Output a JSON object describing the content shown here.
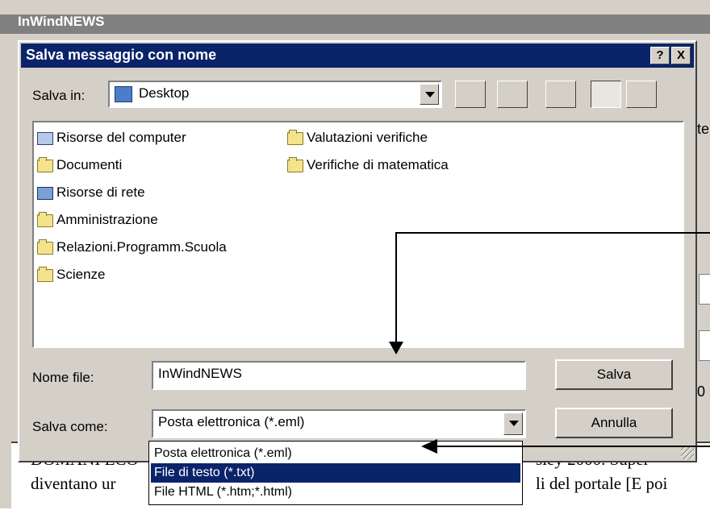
{
  "background": {
    "app_title": "InWindNEWS",
    "doc_lines": [
      "DOMANI ECO",
      "diventano ur",
      "sley 2000.   Super",
      "li del portale [E poi"
    ],
    "right_glyphs": [
      "te",
      "0"
    ]
  },
  "dialog": {
    "title": "Salva messaggio con nome",
    "help_label": "?",
    "close_label": "X",
    "save_in_label": "Salva in:",
    "save_in_value": "Desktop",
    "files_col1": [
      "Risorse del computer",
      "Documenti",
      "Risorse di rete",
      "Amministrazione",
      "Relazioni.Programm.Scuola",
      "Scienze"
    ],
    "files_col2": [
      "Valutazioni verifiche",
      "Verifiche di matematica"
    ],
    "filename_label": "Nome file:",
    "filename_value": "InWindNEWS",
    "saveas_label": "Salva come:",
    "saveas_value": "Posta elettronica (*.eml)",
    "save_button": "Salva",
    "cancel_button": "Annulla",
    "type_options": [
      "Posta elettronica (*.eml)",
      "File di testo (*.txt)",
      "File HTML (*.htm;*.html)"
    ],
    "selected_option_index": 1
  },
  "colors": {
    "titlebar": "#0a246a",
    "face": "#d4d0c8",
    "highlight": "#0a246a"
  }
}
